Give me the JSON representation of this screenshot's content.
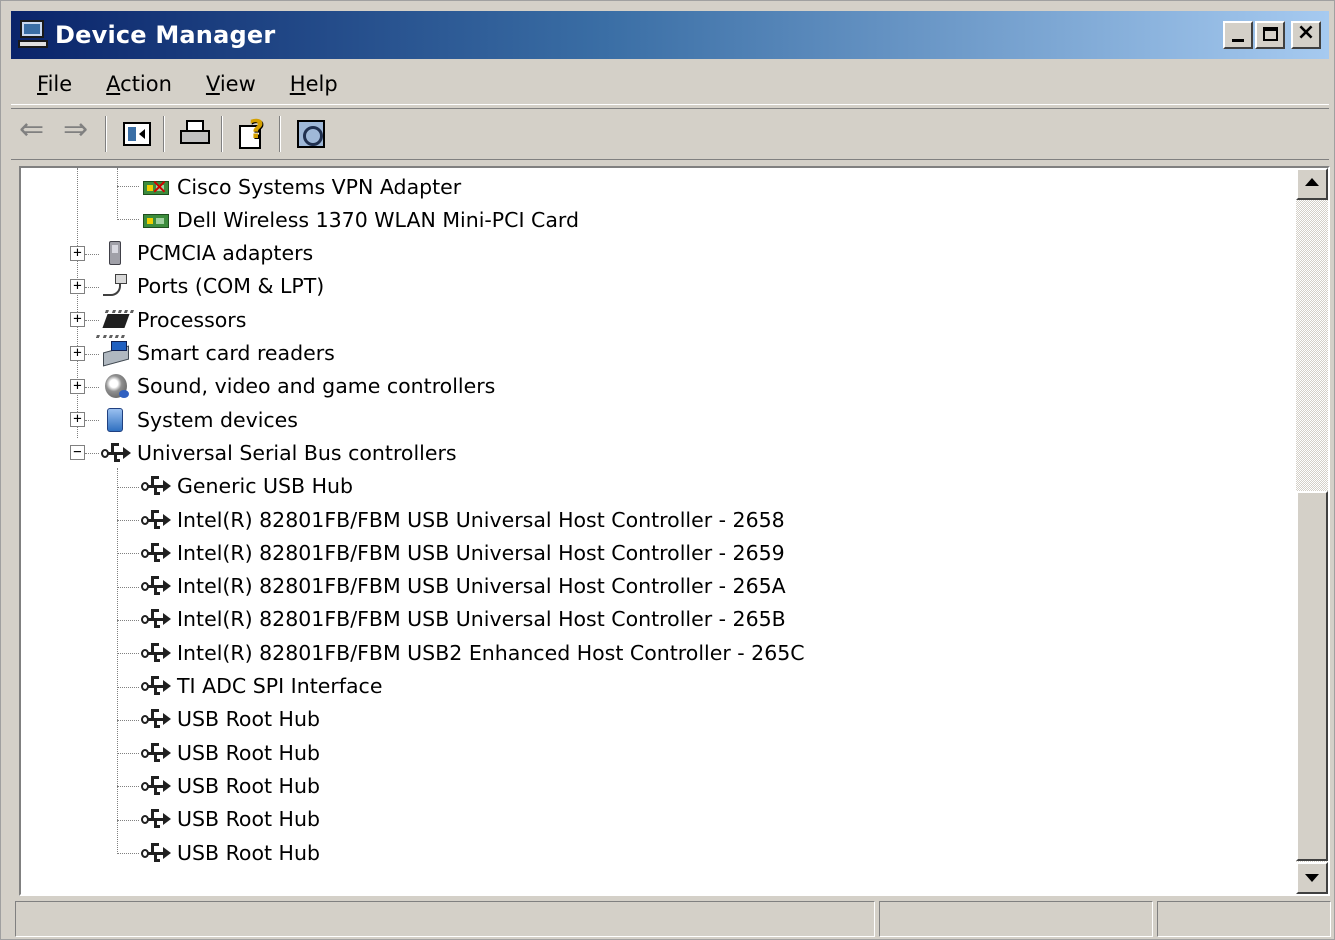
{
  "window": {
    "title": "Device Manager"
  },
  "menu": {
    "items": [
      {
        "label": "File",
        "accel": "F",
        "rest": "ile"
      },
      {
        "label": "Action",
        "accel": "A",
        "rest": "ction"
      },
      {
        "label": "View",
        "accel": "V",
        "rest": "iew"
      },
      {
        "label": "Help",
        "accel": "H",
        "rest": "elp"
      }
    ]
  },
  "toolbar": {
    "buttons": [
      "back-icon",
      "forward-icon",
      "show-hide-console-tree-icon",
      "print-icon",
      "help-icon",
      "scan-hardware-icon"
    ]
  },
  "tree": {
    "items": [
      {
        "label": "Cisco Systems VPN Adapter",
        "level": 2,
        "icon": "network-adapter-disabled-icon"
      },
      {
        "label": "Dell Wireless 1370 WLAN Mini-PCI Card",
        "level": 2,
        "icon": "network-adapter-icon"
      },
      {
        "label": "PCMCIA adapters",
        "level": 1,
        "icon": "pcmcia-icon",
        "expander": "+"
      },
      {
        "label": "Ports (COM & LPT)",
        "level": 1,
        "icon": "port-icon",
        "expander": "+"
      },
      {
        "label": "Processors",
        "level": 1,
        "icon": "processor-icon",
        "expander": "+"
      },
      {
        "label": "Smart card readers",
        "level": 1,
        "icon": "smart-card-reader-icon",
        "expander": "+"
      },
      {
        "label": "Sound, video and game controllers",
        "level": 1,
        "icon": "sound-icon",
        "expander": "+"
      },
      {
        "label": "System devices",
        "level": 1,
        "icon": "system-devices-icon",
        "expander": "+"
      },
      {
        "label": "Universal Serial Bus controllers",
        "level": 1,
        "icon": "usb-icon",
        "expander": "−"
      },
      {
        "label": "Generic USB Hub",
        "level": 2,
        "icon": "usb-icon"
      },
      {
        "label": "Intel(R) 82801FB/FBM USB Universal Host Controller - 2658",
        "level": 2,
        "icon": "usb-icon"
      },
      {
        "label": "Intel(R) 82801FB/FBM USB Universal Host Controller - 2659",
        "level": 2,
        "icon": "usb-icon"
      },
      {
        "label": "Intel(R) 82801FB/FBM USB Universal Host Controller - 265A",
        "level": 2,
        "icon": "usb-icon"
      },
      {
        "label": "Intel(R) 82801FB/FBM USB Universal Host Controller - 265B",
        "level": 2,
        "icon": "usb-icon"
      },
      {
        "label": "Intel(R) 82801FB/FBM USB2 Enhanced Host Controller - 265C",
        "level": 2,
        "icon": "usb-icon"
      },
      {
        "label": "TI ADC SPI Interface",
        "level": 2,
        "icon": "usb-icon"
      },
      {
        "label": "USB Root Hub",
        "level": 2,
        "icon": "usb-icon"
      },
      {
        "label": "USB Root Hub",
        "level": 2,
        "icon": "usb-icon"
      },
      {
        "label": "USB Root Hub",
        "level": 2,
        "icon": "usb-icon"
      },
      {
        "label": "USB Root Hub",
        "level": 2,
        "icon": "usb-icon"
      },
      {
        "label": "USB Root Hub",
        "level": 2,
        "icon": "usb-icon"
      }
    ]
  },
  "status": {
    "panes": [
      "",
      "",
      ""
    ]
  },
  "colors": {
    "title_start": "#0a246a",
    "title_end": "#a6caf0",
    "chrome": "#d4d0c8"
  }
}
